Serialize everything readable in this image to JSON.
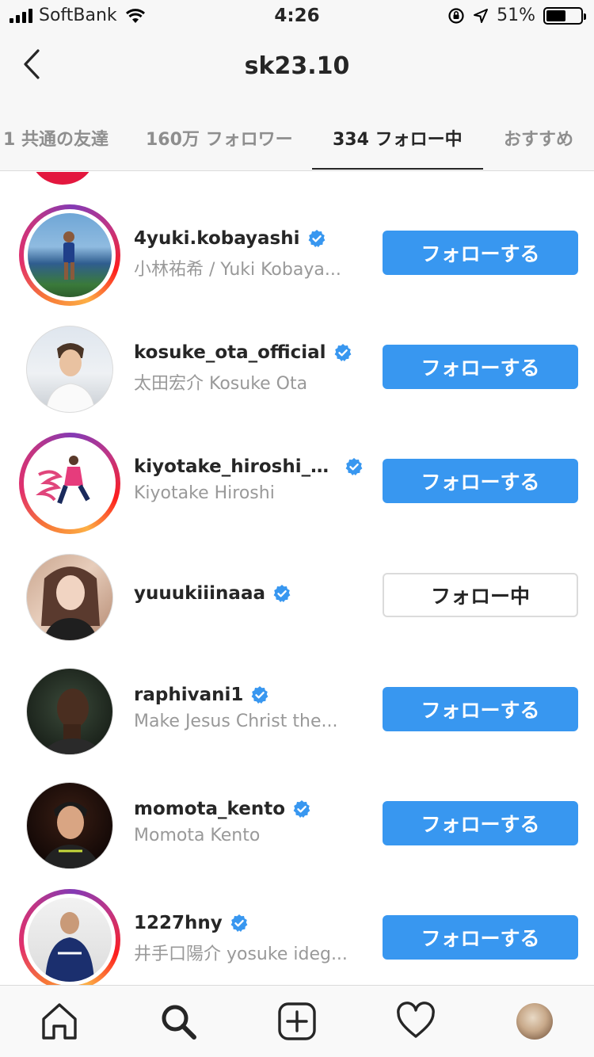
{
  "status_bar": {
    "carrier": "SoftBank",
    "time": "4:26",
    "battery_percent": "51%",
    "battery_level": 0.51
  },
  "header": {
    "title": "sk23.10",
    "back_icon": "chevron-left-icon"
  },
  "tabs": [
    {
      "label": "1 共通の友達",
      "active": false
    },
    {
      "label": "160万 フォロワー",
      "active": false
    },
    {
      "label": "334 フォロー中",
      "active": true
    },
    {
      "label": "おすすめ",
      "active": false
    }
  ],
  "users": [
    {
      "username": "4yuki.kobayashi",
      "full_name": "小林祐希 / Yuki Kobaya...",
      "verified": true,
      "story_ring": true,
      "button": "フォローする",
      "following": false
    },
    {
      "username": "kosuke_ota_official",
      "full_name": "太田宏介 Kosuke Ota",
      "verified": true,
      "story_ring": false,
      "button": "フォローする",
      "following": false
    },
    {
      "username": "kiyotake_hiroshi_o...",
      "full_name": "Kiyotake Hiroshi",
      "verified": true,
      "story_ring": true,
      "button": "フォローする",
      "following": false
    },
    {
      "username": "yuuukiiinaaa",
      "full_name": "",
      "verified": true,
      "story_ring": false,
      "button": "フォロー中",
      "following": true
    },
    {
      "username": "raphivani1",
      "full_name": "Make Jesus Christ the...",
      "verified": true,
      "story_ring": false,
      "button": "フォローする",
      "following": false
    },
    {
      "username": "momota_kento",
      "full_name": "Momota Kento",
      "verified": true,
      "story_ring": false,
      "button": "フォローする",
      "following": false
    },
    {
      "username": "1227hny",
      "full_name": "井手口陽介 yosuke ideg...",
      "verified": true,
      "story_ring": true,
      "button": "フォローする",
      "following": false
    }
  ],
  "bottom_nav": {
    "items": [
      "home-icon",
      "search-icon",
      "add-post-icon",
      "activity-heart-icon",
      "profile-avatar"
    ]
  },
  "colors": {
    "follow_button": "#3897f0",
    "verified_badge": "#3897f0",
    "secondary_text": "#999999"
  }
}
